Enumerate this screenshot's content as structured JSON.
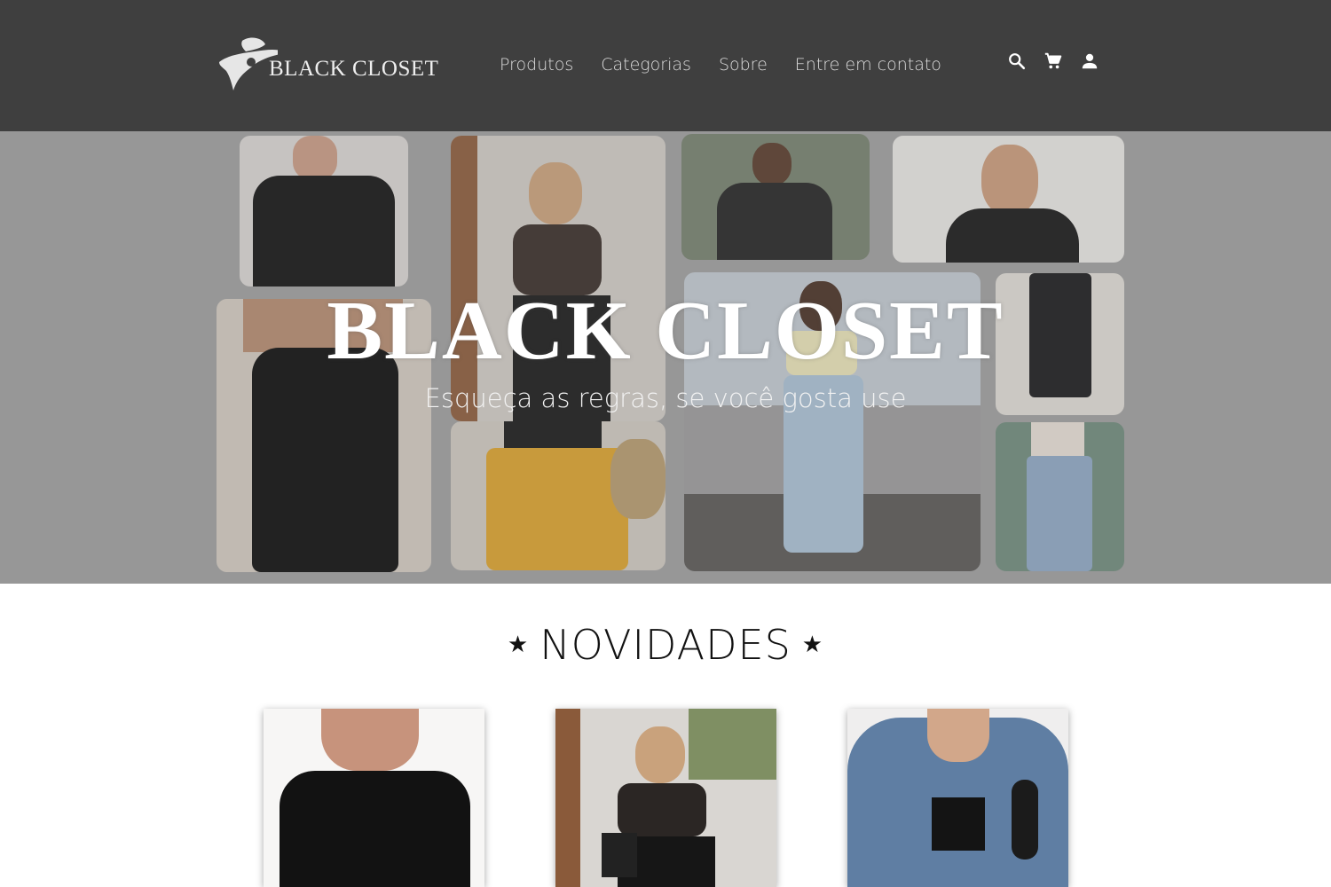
{
  "header": {
    "logo_text": "BLACK CLOSET",
    "nav": [
      "Produtos",
      "Categorias",
      "Sobre",
      "Entre em contato"
    ],
    "icons": [
      "search-icon",
      "cart-icon",
      "account-icon"
    ]
  },
  "hero": {
    "title": "BLACK CLOSET",
    "subtitle": "Esqueça as regras, se você gosta use"
  },
  "novidades": {
    "star_left": "★",
    "title": "NOVIDADES",
    "star_right": "★",
    "products": [
      "off-shoulder black dress",
      "black lace top with wide pants",
      "denim jacket with black crop top"
    ]
  },
  "colors": {
    "header_bg": "#3f3f3f",
    "hero_bg": "#9e9e9e",
    "text_dark": "#111111"
  }
}
